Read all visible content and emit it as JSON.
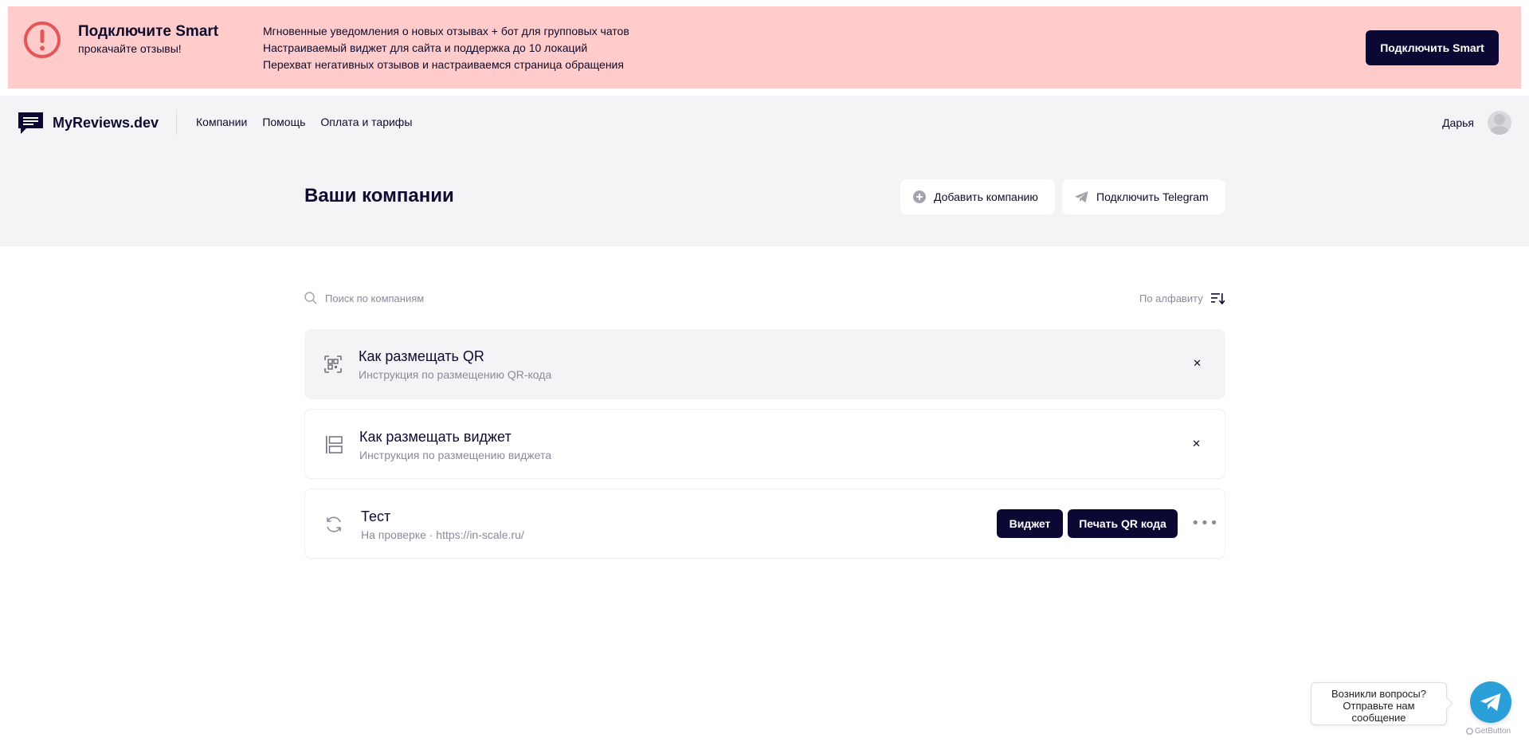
{
  "promo": {
    "title": "Подключите Smart",
    "subtitle": "прокачайте отзывы!",
    "features": [
      "Мгновенные уведомления о новых отзывах + бот для групповых чатов",
      "Настраиваемый виджет для сайта и поддержка до 10 локаций",
      "Перехват негативных отзывов и настраиваемся страница обращения"
    ],
    "button_label": "Подключить Smart",
    "background": "#ffcccb",
    "icon": "alert-circle-icon",
    "icon_color": "#e35757"
  },
  "header": {
    "logo_text": "MyReviews.dev",
    "logo_icon": "chat-bubble-icon",
    "nav": [
      "Компании",
      "Помощь",
      "Оплата и тарифы"
    ],
    "user_name": "Дарья"
  },
  "page": {
    "title": "Ваши компании",
    "add_company_label": "Добавить компанию",
    "connect_telegram_label": "Подключить Telegram"
  },
  "search": {
    "placeholder": "Поиск по компаниям",
    "sort_label": "По алфавиту"
  },
  "cards": [
    {
      "title": "Как размещать QR",
      "subtitle": "Инструкция по размещению QR-кода",
      "icon": "qr-scan-icon"
    },
    {
      "title": "Как размещать виджет",
      "subtitle": "Инструкция по размещению виджета",
      "icon": "widget-layout-icon"
    }
  ],
  "company": {
    "name": "Тест",
    "status_line": "На проверке · https://in-scale.ru/",
    "icon": "refresh-icon",
    "widget_label": "Виджет",
    "print_qr_label": "Печать QR кода"
  },
  "help": {
    "lines": [
      "Возникли вопросы?",
      "Отправьте нам",
      "сообщение"
    ],
    "brand": "GetButton"
  },
  "colors": {
    "primary_dark": "#0b0833",
    "text": "#0d0b2e",
    "muted": "#8a8a99",
    "surface": "#f4f4f7",
    "telegram": "#2a9fd8"
  }
}
